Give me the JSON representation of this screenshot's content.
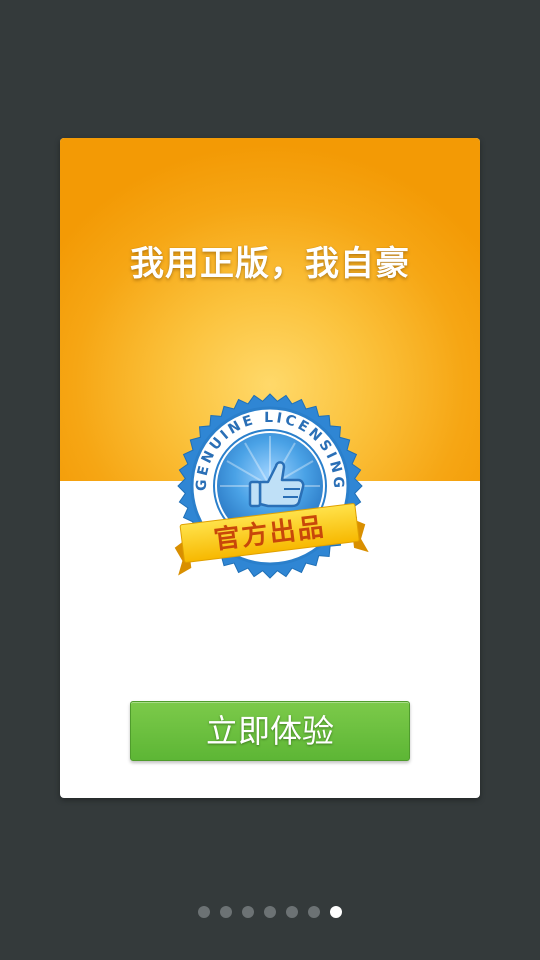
{
  "colors": {
    "background": "#343a3b",
    "hero_orange": "#f39a05",
    "hero_glow": "#ffd96a",
    "badge_blue": "#3a8fd8",
    "ribbon_yellow": "#ffcc00",
    "ribbon_text": "#c8470a",
    "cta_green": "#6cc03e",
    "dot_inactive": "#6c7274",
    "dot_active": "#ffffff"
  },
  "card": {
    "headline": "我用正版，我自豪",
    "badge": {
      "ring_text": "GENUINE LICENSING",
      "ribbon_text": "官方出品",
      "icon": "thumbs-up-icon"
    },
    "cta_label": "立即体验"
  },
  "pager": {
    "total": 7,
    "active_index": 6
  }
}
